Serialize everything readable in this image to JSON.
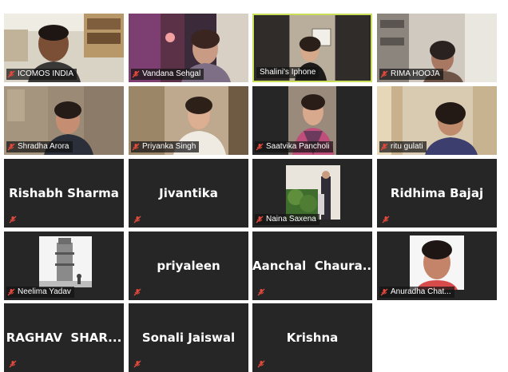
{
  "meeting": {
    "participants": [
      {
        "name": "ICOMOS INDIA",
        "mode": "video"
      },
      {
        "name": "Vandana Sehgal",
        "mode": "video"
      },
      {
        "name": "Shalini's Iphone",
        "mode": "video",
        "active_speaker": true
      },
      {
        "name": "RIMA HOOJA",
        "mode": "video"
      },
      {
        "name": "Shradha Arora",
        "mode": "video"
      },
      {
        "name": "Priyanka Singh",
        "mode": "video"
      },
      {
        "name": "Saatvika Pancholi",
        "mode": "video"
      },
      {
        "name": "ritu gulati",
        "mode": "video"
      },
      {
        "name": "Rishabh Sharma",
        "mode": "name"
      },
      {
        "name": "Jivantika",
        "mode": "name"
      },
      {
        "name": "Naina Saxena",
        "mode": "photo"
      },
      {
        "name": "Ridhima Bajaj",
        "mode": "name"
      },
      {
        "name": "Neelima Yadav",
        "mode": "photo"
      },
      {
        "name": "priyaleen",
        "mode": "name"
      },
      {
        "name": "Aanchal  Chaura...",
        "mode": "name"
      },
      {
        "name": "Anuradha Chat...",
        "mode": "photo"
      },
      {
        "name": "RAGHAV  SHAR...",
        "mode": "name"
      },
      {
        "name": "Sonali Jaiswal",
        "mode": "name"
      },
      {
        "name": "Krishna",
        "mode": "name"
      }
    ],
    "colors": {
      "tile_bg": "#262626",
      "active_border": "#c9df5a",
      "muted_mic": "#e5483c"
    },
    "icons": {
      "muted": "mic-off-icon"
    }
  }
}
